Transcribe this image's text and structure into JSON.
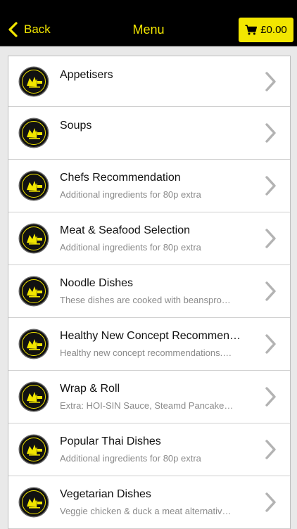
{
  "navbar": {
    "back_label": "Back",
    "title": "Menu",
    "cart_total": "£0.00",
    "accent_color": "#f2e600",
    "icons": {
      "back": "chevron-left-icon",
      "cart": "shopping-cart-icon"
    }
  },
  "menu": {
    "row_icon": "restaurant-logo-icon",
    "disclosure_icon": "chevron-right-icon",
    "items": [
      {
        "title": "Appetisers",
        "subtitle": ""
      },
      {
        "title": "Soups",
        "subtitle": ""
      },
      {
        "title": "Chefs Recommendation",
        "subtitle": "Additional ingredients for 80p extra"
      },
      {
        "title": "Meat & Seafood Selection",
        "subtitle": "Additional ingredients for 80p extra"
      },
      {
        "title": "Noodle Dishes",
        "subtitle": "These dishes are cooked with beanspro…"
      },
      {
        "title": "Healthy New Concept Recommen…",
        "subtitle": "Healthy new concept recommendations.…"
      },
      {
        "title": "Wrap & Roll",
        "subtitle": "Extra: HOI-SIN Sauce, Steamd Pancake…"
      },
      {
        "title": "Popular Thai Dishes",
        "subtitle": "Additional ingredients for 80p extra"
      },
      {
        "title": "Vegetarian Dishes",
        "subtitle": "Veggie chicken & duck a meat alternativ…"
      }
    ]
  }
}
